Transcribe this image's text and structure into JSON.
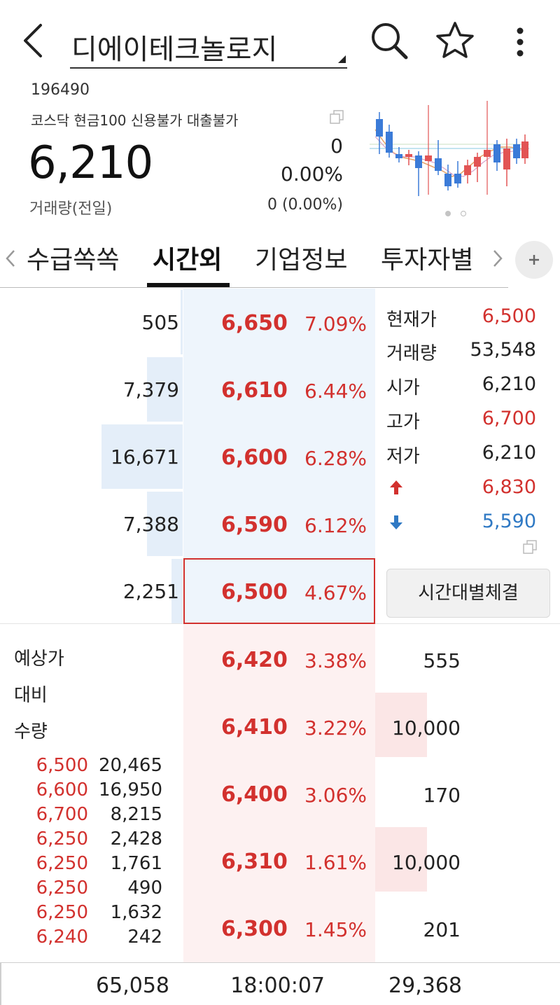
{
  "header": {
    "stock_name": "디에이테크놀로지"
  },
  "stock": {
    "code": "196490",
    "tags": "코스닥 현금100 신용불가 대출불가",
    "price": "6,210",
    "change": "0",
    "change_rate": "0.00%",
    "volume_label": "거래량(전일)",
    "volume_value": "0  (0.00%)"
  },
  "tabs": [
    "수급쏙쏙",
    "시간외",
    "기업정보",
    "투자자별"
  ],
  "ask_rows": [
    {
      "qty": "505",
      "price": "6,650",
      "rate": "7.09%",
      "depth": 0.01
    },
    {
      "qty": "7,379",
      "price": "6,610",
      "rate": "6.44%",
      "depth": 0.44
    },
    {
      "qty": "16,671",
      "price": "6,600",
      "rate": "6.28%",
      "depth": 1.0
    },
    {
      "qty": "7,388",
      "price": "6,590",
      "rate": "6.12%",
      "depth": 0.44
    },
    {
      "qty": "2,251",
      "price": "6,500",
      "rate": "4.67%",
      "depth": 0.14
    }
  ],
  "bid_rows": [
    {
      "price": "6,420",
      "rate": "3.38%",
      "qty": "555",
      "depth": 0.0
    },
    {
      "price": "6,410",
      "rate": "3.22%",
      "qty": "10,000",
      "depth": 1.0
    },
    {
      "price": "6,400",
      "rate": "3.06%",
      "qty": "170",
      "depth": 0.0
    },
    {
      "price": "6,310",
      "rate": "1.61%",
      "qty": "10,000",
      "depth": 1.0
    },
    {
      "price": "6,300",
      "rate": "1.45%",
      "qty": "201",
      "depth": 0.0
    }
  ],
  "info_panel": {
    "current_label": "현재가",
    "current_value": "6,500",
    "volume_label": "거래량",
    "volume_value": "53,548",
    "open_label": "시가",
    "open_value": "6,210",
    "high_label": "고가",
    "high_value": "6,700",
    "low_label": "저가",
    "low_value": "6,210",
    "upper_limit": "6,830",
    "lower_limit": "5,590",
    "time_trade_button": "시간대별체결"
  },
  "bid_side_labels": {
    "expected_price": "예상가",
    "compare": "대비",
    "quantity": "수량"
  },
  "trades": [
    {
      "price": "6,500",
      "qty": "20,465"
    },
    {
      "price": "6,600",
      "qty": "16,950"
    },
    {
      "price": "6,700",
      "qty": "8,215"
    },
    {
      "price": "6,250",
      "qty": "2,428"
    },
    {
      "price": "6,250",
      "qty": "1,761"
    },
    {
      "price": "6,250",
      "qty": "490"
    },
    {
      "price": "6,250",
      "qty": "1,632"
    },
    {
      "price": "6,240",
      "qty": "242"
    }
  ],
  "totals": {
    "ask_total": "65,058",
    "time": "18:00:07",
    "bid_total": "29,368"
  },
  "colors": {
    "up": "#d2312e",
    "down": "#2f79c4",
    "ask_bg": "#eef5fc",
    "bid_bg": "#fdf1f1"
  },
  "icons": {
    "back": "back-arrow-icon",
    "search": "search-icon",
    "favorite": "star-icon",
    "more": "more-vertical-icon",
    "add_tab": "plus-icon",
    "copy": "copy-icon",
    "upper": "up-arrow-icon",
    "lower": "down-arrow-icon"
  }
}
